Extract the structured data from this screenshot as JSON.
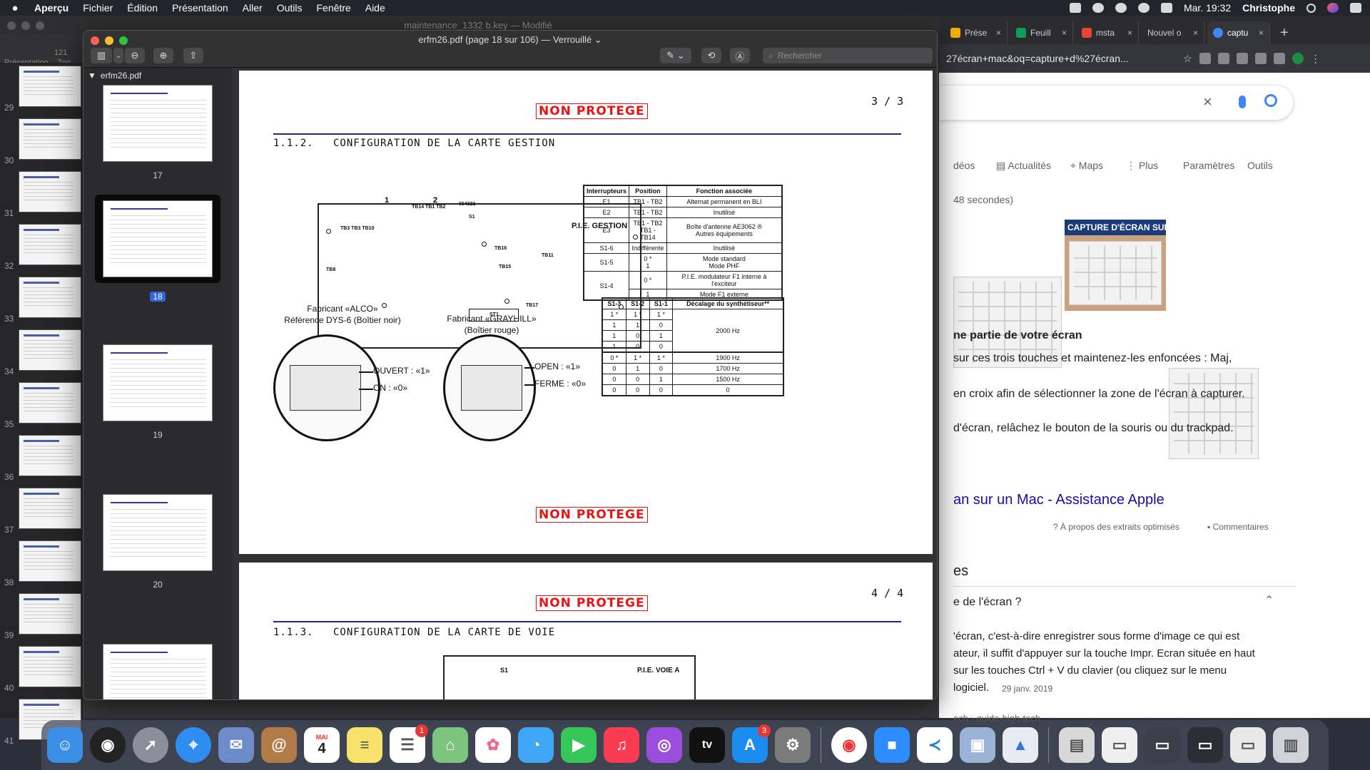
{
  "menubar": {
    "app_name": "Aperçu",
    "items": [
      "Fichier",
      "Édition",
      "Présentation",
      "Aller",
      "Outils",
      "Fenêtre",
      "Aide"
    ],
    "clock": "Mar. 19:32",
    "user": "Christophe"
  },
  "keynote": {
    "title": "maintenance_1332 b.key — Modifié",
    "toolbar_labels": [
      "Présentation",
      "Zoo"
    ],
    "zoom_partial": "121",
    "slide_numbers": [
      "29",
      "30",
      "31",
      "32",
      "33",
      "34",
      "35",
      "36",
      "37",
      "38",
      "39",
      "40",
      "41"
    ]
  },
  "preview": {
    "title": "erfm26.pdf (page 18 sur 106) — Verrouillé ⌄",
    "search_placeholder": "Rechercher",
    "sidebar_file": "erfm26.pdf",
    "thumbnails": [
      {
        "label": "17",
        "selected": false
      },
      {
        "label": "18",
        "selected": true
      },
      {
        "label": "19",
        "selected": false
      },
      {
        "label": "20",
        "selected": false
      }
    ]
  },
  "document": {
    "page1": {
      "stamp_top": "NON PROTEGE",
      "page_number": "3 / 3",
      "section_number": "1.1.2.",
      "section_title": "CONFIGURATION DE LA CARTE GESTION",
      "pcb_label": "P.I.E. GESTION",
      "pcb_callouts": [
        "1",
        "2"
      ],
      "pcb_tiny_labels": [
        "TB3 TB3 TB10",
        "TB14 TB1 TB2",
        "654321",
        "S1",
        "TB16",
        "TB15",
        "TB11",
        "TB8",
        "TB17",
        "ST1"
      ],
      "table1": {
        "headers": [
          "Interrupteurs",
          "Position",
          "Fonction associée"
        ],
        "rows": [
          [
            "E1",
            "TB1 - TB2",
            "Alternat permanent en BLI"
          ],
          [
            "E2",
            "TB1 - TB2",
            "Inutilisé"
          ],
          [
            "E3",
            "TB1 - TB2\nTB1 - TB14",
            "Boîte d'antenne AE3062 ®\nAutres équipements"
          ],
          [
            "S1-6",
            "Indifférente",
            "Inutilisé"
          ],
          [
            "S1-5",
            "0 *\n1",
            "Mode standard\nMode PHF"
          ],
          [
            "S1-4",
            "0 *",
            "P.I.E. modulateur F1 interne à l'exciteur"
          ],
          [
            "",
            "1",
            "Mode F1 externe"
          ]
        ]
      },
      "table2": {
        "headers": [
          "S1-3",
          "S1-2",
          "S1-1",
          "Décalage du synthétiseur**"
        ],
        "rows": [
          [
            "1 *",
            "1 *",
            "1 *",
            ""
          ],
          [
            "1",
            "1",
            "0",
            "2000 Hz"
          ],
          [
            "1",
            "0",
            "1",
            ""
          ],
          [
            "1",
            "0",
            "0",
            ""
          ],
          [
            "0 *",
            "1 *",
            "1 *",
            "1900 Hz"
          ],
          [
            "0",
            "1",
            "0",
            "1700 Hz"
          ],
          [
            "0",
            "0",
            "1",
            "1500 Hz"
          ],
          [
            "0",
            "0",
            "0",
            "0"
          ]
        ]
      },
      "fabricant1": "Fabricant «ALCO»\nRéférence DYS-6 (Boîtier noir)",
      "fabricant2": "Fabricant «GRAYHILL»\n(Boîtier rouge)",
      "alco_open": "OUVERT : «1»",
      "alco_on": "ON : «0»",
      "gray_open": "OPEN : «1»",
      "gray_closed": "FERME : «0»",
      "stamp_bottom": "NON PROTEGE"
    },
    "page2": {
      "stamp_top": "NON PROTEGE",
      "page_number": "4 / 4",
      "section_number": "1.1.3.",
      "section_title": "CONFIGURATION DE LA CARTE DE VOIE",
      "pcb_label": "P.I.E. VOIE A",
      "pcb_tiny": "S1"
    }
  },
  "chrome": {
    "tabs": [
      {
        "label": "Prése",
        "color": "#f4b400"
      },
      {
        "label": "Feuill",
        "color": "#0f9d58"
      },
      {
        "label": "msta",
        "color": "#ea4335"
      },
      {
        "label": "Nouvel o",
        "color": "#5f6368"
      },
      {
        "label": "captu",
        "color": "#4285f4",
        "active": true
      }
    ],
    "address": "27écran+mac&oq=capture+d%27écran...",
    "nav": [
      "déos",
      "Actualités",
      "Maps",
      "Plus",
      "Paramètres",
      "Outils"
    ],
    "stats": "48 secondes)",
    "image_caption": "CAPTURE D'ÉCRAN SUR",
    "snippet_heading": "ne partie de votre écran",
    "lines": [
      "sur ces trois touches et maintenez-les enfoncées : Maj,",
      "en croix afin de sélectionner la zone de l'écran à capturer.",
      "d'écran, relâchez le bouton de la souris ou du trackpad."
    ],
    "result_link": "an sur un Mac - Assistance Apple",
    "about_snippets": "À propos des extraits optimisés",
    "comments": "Commentaires",
    "paa_header": "es",
    "paa_question": "e de l'écran ?",
    "answer_lines": [
      "'écran, c'est-à-dire enregistrer sous forme d'image ce qui est",
      "ateur, il suffit d'appuyer sur la touche Impr. Ecran située en haut",
      "sur les touches Ctrl + V du clavier (ou cliquez sur le menu",
      "logiciel."
    ],
    "answer_date": "29 janv. 2019",
    "breadcrumb": "ech › guide-high-tech"
  },
  "dock": {
    "apps": [
      {
        "name": "finder",
        "color": "#3b8fe6",
        "glyph": "☺"
      },
      {
        "name": "siri",
        "color": "#222",
        "glyph": "◉"
      },
      {
        "name": "launchpad",
        "color": "#8a8f99",
        "glyph": "🚀"
      },
      {
        "name": "safari",
        "color": "#2f8cf0",
        "glyph": "⌖"
      },
      {
        "name": "mail",
        "color": "#6d8bc9",
        "glyph": "✉"
      },
      {
        "name": "contacts",
        "color": "#b07b46",
        "glyph": "@"
      },
      {
        "name": "calendar",
        "color": "#ffffff",
        "glyph": "4",
        "text": "MAI"
      },
      {
        "name": "notes",
        "color": "#f7e36b",
        "glyph": "≡"
      },
      {
        "name": "reminders",
        "color": "#ffffff",
        "glyph": "☰",
        "badge": "1"
      },
      {
        "name": "maps",
        "color": "#7dc47f",
        "glyph": "⌂"
      },
      {
        "name": "photos",
        "color": "#ffffff",
        "glyph": "✿"
      },
      {
        "name": "messages",
        "color": "#3ea6f5",
        "glyph": "💬"
      },
      {
        "name": "facetime",
        "color": "#35c759",
        "glyph": "▶"
      },
      {
        "name": "music",
        "color": "#fa3c52",
        "glyph": "♫"
      },
      {
        "name": "podcasts",
        "color": "#9b4dde",
        "glyph": "◎"
      },
      {
        "name": "tv",
        "color": "#111",
        "glyph": "tv"
      },
      {
        "name": "app-store",
        "color": "#1a8cf2",
        "glyph": "A",
        "badge": "3"
      },
      {
        "name": "system-preferences",
        "color": "#7b7b7b",
        "glyph": "⚙"
      }
    ],
    "recent": [
      {
        "name": "chrome",
        "color": "#ffffff",
        "glyph": "◉"
      },
      {
        "name": "zoom",
        "color": "#2d8cff",
        "glyph": "■"
      },
      {
        "name": "vscode",
        "color": "#ffffff",
        "glyph": "≺"
      },
      {
        "name": "preview",
        "color": "#9ab3d6",
        "glyph": "▣"
      },
      {
        "name": "keynote",
        "color": "#e7ecf2",
        "glyph": "▲"
      }
    ],
    "docs": [
      {
        "name": "archive-utility",
        "color": "#d8d8d8",
        "glyph": "▤"
      },
      {
        "name": "window-chrome",
        "color": "#f0f0f0",
        "glyph": "▭"
      },
      {
        "name": "window-zoom",
        "color": "#3a3f4a",
        "glyph": "▭"
      },
      {
        "name": "window-vscode",
        "color": "#2a2d34",
        "glyph": "▭"
      },
      {
        "name": "window-chrome-2",
        "color": "#e9e9e9",
        "glyph": "▭"
      },
      {
        "name": "trash",
        "color": "#cfd3d8",
        "glyph": "🗑"
      }
    ]
  }
}
